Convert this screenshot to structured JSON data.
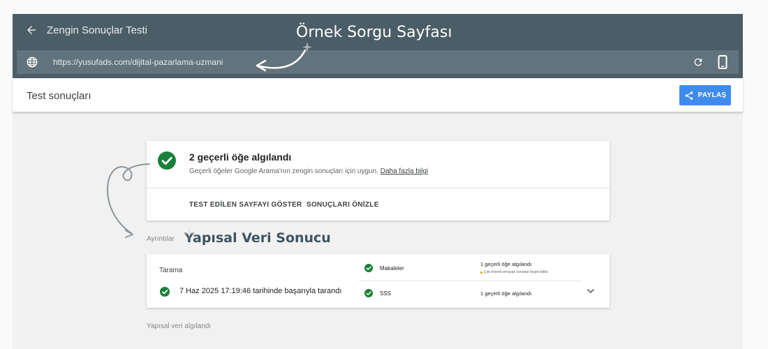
{
  "header": {
    "title": "Zengin Sonuçlar Testi",
    "url": "https://yusufads.com/dijital-pazarlama-uzmani"
  },
  "results_bar": {
    "title": "Test sonuçları",
    "share_label": "PAYLAŞ"
  },
  "summary": {
    "title": "2 geçerli öğe algılandı",
    "description": "Geçerli öğeler Google Arama'nın zengin sonuçları için uygun.",
    "learn_more": "Daha fazla bilgi",
    "actions": [
      "TEST EDİLEN SAYFAYI GÖSTER",
      "SONUÇLARI ÖNİZLE"
    ]
  },
  "details": {
    "label": "Ayrıntılar",
    "crawl_heading": "Tarama",
    "crawl_status": "7 Haz 2025 17:19:46 tarihinde başarıyla tarandı",
    "types": [
      {
        "name": "Makaleler",
        "count": "1 geçerli öğe algılandı",
        "note": "Çok önemli olmayan sorunlar tespit edildi"
      },
      {
        "name": "SSS",
        "count": "1 geçerli öğe algılandı",
        "note": ""
      }
    ]
  },
  "footer_label": "Yapısal veri algılandı",
  "annotations": {
    "query_page": "Örnek Sorgu Sayfası",
    "structured_data": "Yapısal Veri Sonucu"
  },
  "colors": {
    "topbar": "#4b5d67",
    "urlbar": "#61737c",
    "accent_blue": "#3f8bed",
    "success_green": "#188038",
    "warning_orange": "#f29900"
  },
  "icons": [
    "back-arrow-icon",
    "globe-icon",
    "reload-icon",
    "phone-icon",
    "share-icon",
    "check-circle-icon",
    "chevron-down-icon"
  ]
}
